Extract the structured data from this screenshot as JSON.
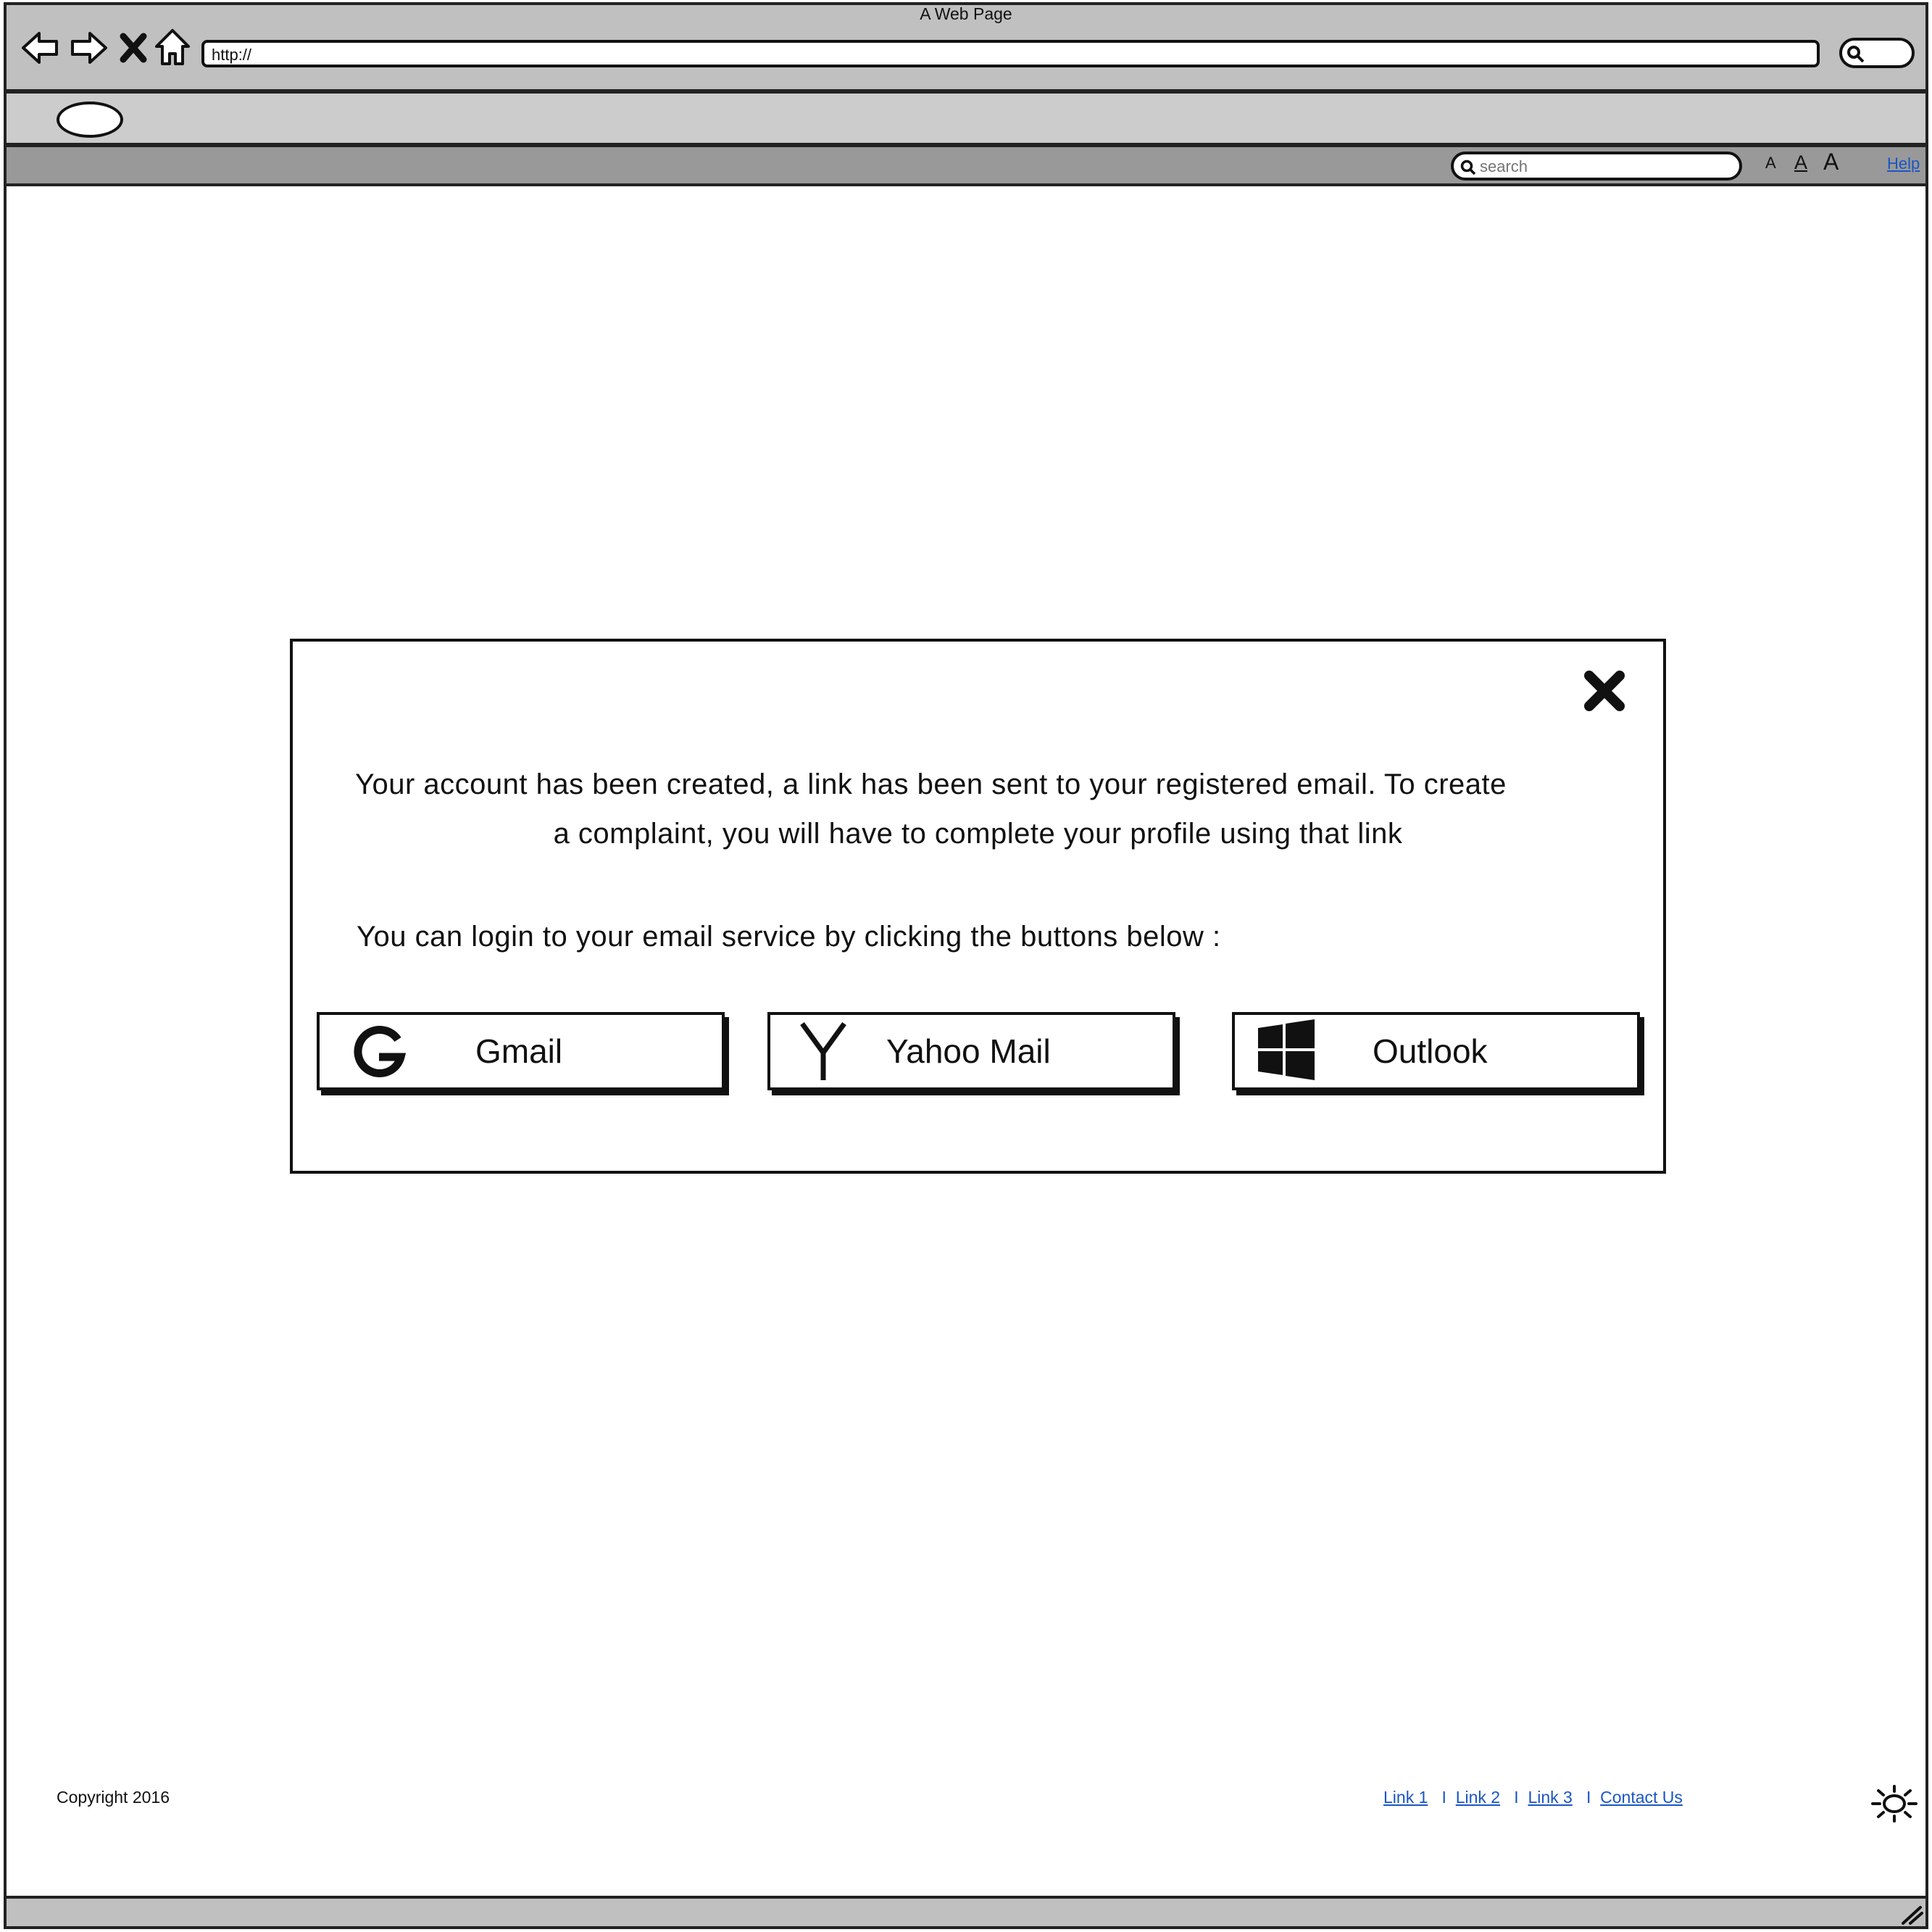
{
  "browser": {
    "title": "A Web Page",
    "url": "http://"
  },
  "toolbar": {
    "search_placeholder": "search",
    "font_small": "A",
    "font_medium": "A",
    "font_large": "A",
    "help": "Help"
  },
  "dialog": {
    "message_line1": "Your account has been created, a link has been sent to your registered email. To create",
    "message_line2": "a complaint, you will have to complete your profile using that link",
    "message_line3": "You can login to your email service by clicking the buttons below :",
    "buttons": [
      {
        "label": "Gmail",
        "icon": "google-icon"
      },
      {
        "label": "Yahoo Mail",
        "icon": "yahoo-icon"
      },
      {
        "label": "Outlook",
        "icon": "windows-icon"
      }
    ]
  },
  "footer": {
    "copyright": "Copyright 2016",
    "links": [
      "Link 1",
      "Link 2",
      "Link 3",
      "Contact Us"
    ],
    "separator": "I"
  }
}
